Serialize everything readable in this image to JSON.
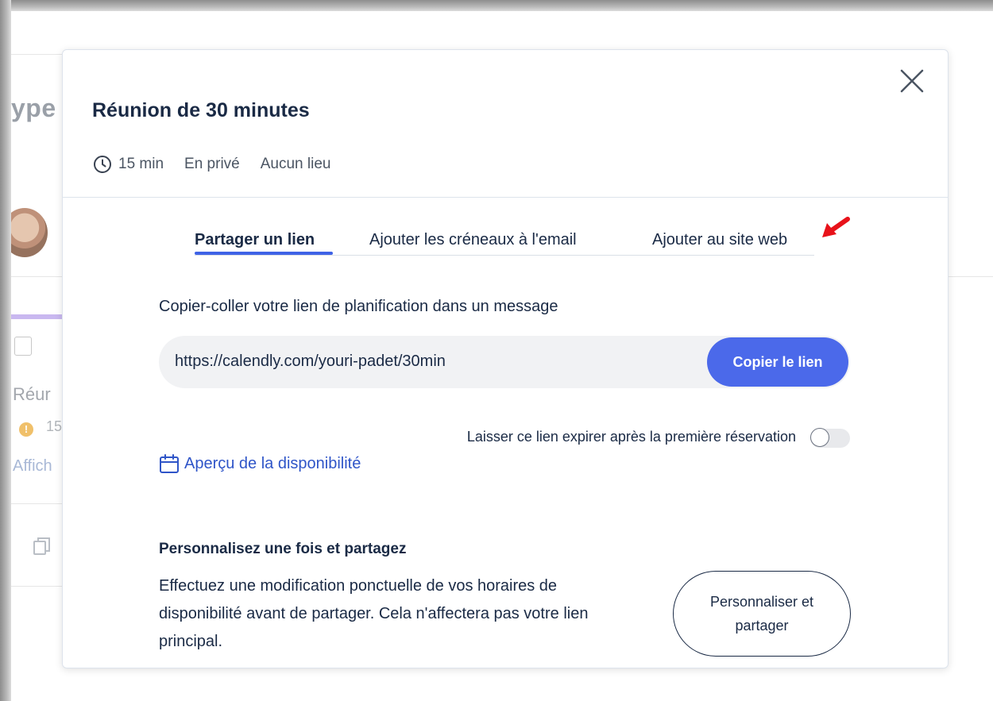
{
  "background": {
    "title_fragment": "ype",
    "event_name_fragment": "Réur",
    "duration_fragment": "15",
    "link_fragment": "Affich"
  },
  "modal": {
    "title": "Réunion de 30 minutes",
    "meta": {
      "duration": "15 min",
      "visibility": "En privé",
      "location": "Aucun lieu"
    },
    "tabs": [
      {
        "label": "Partager un lien",
        "active": true
      },
      {
        "label": "Ajouter les créneaux à l'email",
        "active": false
      },
      {
        "label": "Ajouter au site web",
        "active": false
      }
    ],
    "share": {
      "instruction": "Copier-coller votre lien de planification dans un message",
      "link": "https://calendly.com/youri-padet/30min",
      "copy_button": "Copier le lien",
      "expire_label": "Laisser ce lien expirer après la première réservation",
      "expire_enabled": false,
      "preview_link": "Aperçu de la disponibilité"
    },
    "customize": {
      "title": "Personnalisez une fois et partagez",
      "description": "Effectuez une modification ponctuelle de vos horaires de disponibilité avant de partager. Cela n'affectera pas votre lien principal.",
      "button": "Personnaliser et partager"
    }
  },
  "colors": {
    "primary": "#4b69ea",
    "tab_underline": "#3f63e6",
    "link": "#2f55c8",
    "text": "#1a2a45",
    "annotation_arrow": "#e8121a"
  },
  "icons": {
    "close": "close-icon",
    "clock": "clock-icon",
    "calendar": "calendar-icon",
    "annotation": "red-arrow-icon"
  }
}
